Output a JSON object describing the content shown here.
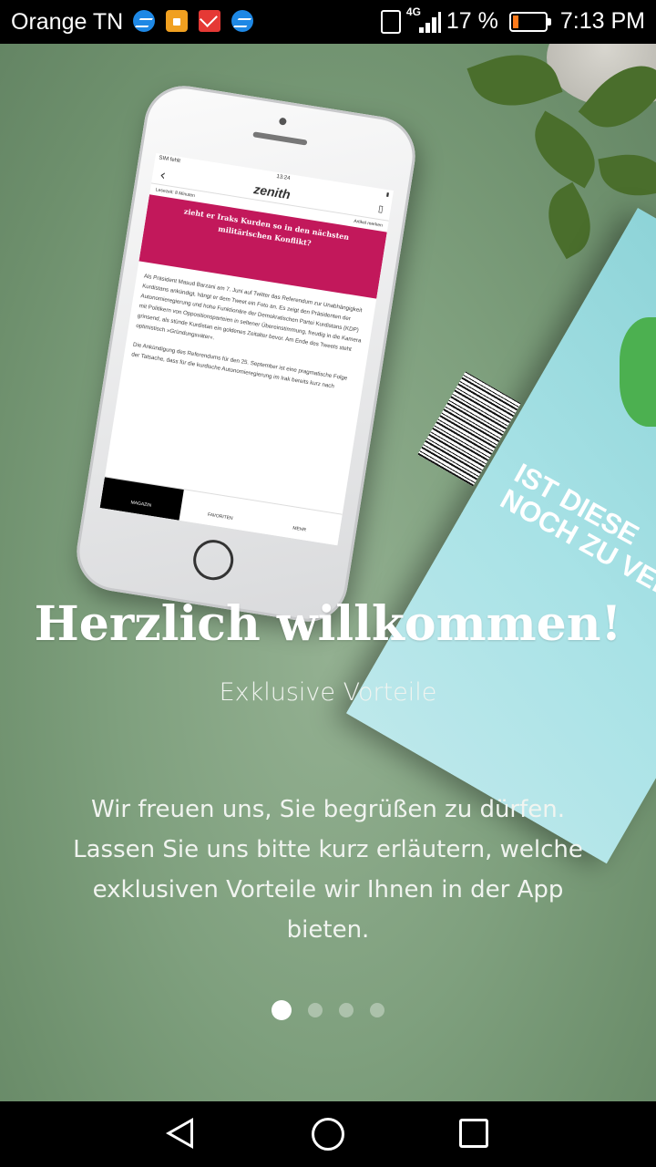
{
  "status_bar": {
    "carrier": "Orange TN",
    "notification_icons": [
      "messenger-icon",
      "lock-app-icon",
      "gmail-icon",
      "messenger-icon"
    ],
    "network": "4G",
    "battery_percent": "17 %",
    "time": "7:13 PM"
  },
  "illustration": {
    "phone_screen": {
      "status_left": "SIM fehlt",
      "status_time": "13:24",
      "logo": "zenith",
      "reading_time": "Lesezeit: 8 Minuten",
      "bookmark": "Artikel merken",
      "headline": "zieht er Iraks Kurden so in den nächsten militärischen Konflikt?",
      "body_1": "Als Präsident Masud Barzani am 7. Juni auf Twitter das Referendum zur Unabhängigkeit Kurdistans ankündigt, hängt er dem Tweet ein Foto an. Es zeigt den Präsidenten der Autonomieregierung und hohe Funktionäre der Demokratischen Partei Kurdistans (KDP) mit Politikern von Oppositionsparteien in seltener Übereinstimmung, freudig in die Kamera grinsend, als stünde Kurdistan ein goldenes Zeitalter bevor. Am Ende des Tweets steht optimistisch »Gründungsväter«.",
      "body_2": "Die Ankündigung des Referendums für den 25. September ist eine pragmatische Folge der Tatsache, dass für die kurdische Autonomieregierung im Irak bereits kurz nach",
      "tabs": [
        "MAGAZIN",
        "FAVORITEN",
        "MEHR"
      ]
    },
    "magazine_cover_text": [
      "IST DIESE",
      "NOCH ZU VERH"
    ]
  },
  "onboarding": {
    "title": "Herzlich willkommen!",
    "subtitle": "Exklusive Vorteile",
    "description": "Wir freuen uns, Sie begrüßen zu dürfen. Lassen Sie uns bitte kurz erläutern, welche exklusiven Vorteile wir Ihnen in der App bieten.",
    "page_count": 4,
    "current_page": 1
  },
  "navigation_bar": {
    "buttons": [
      "back-icon",
      "home-icon",
      "recent-apps-icon"
    ]
  },
  "colors": {
    "background_green": "#7fa07e",
    "banner_magenta": "#c2185b",
    "magazine_teal": "#9edbe0"
  }
}
